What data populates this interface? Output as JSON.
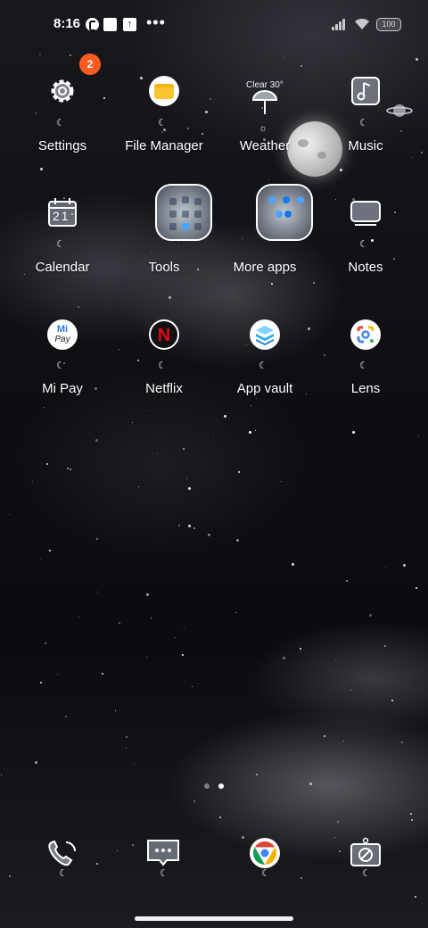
{
  "status_bar": {
    "time": "8:16",
    "battery": "100",
    "icons": [
      "notification-c-icon",
      "notification-square-icon",
      "upload-icon",
      "more-dots-icon",
      "signal-icon",
      "wifi-icon",
      "battery-icon"
    ]
  },
  "apps": [
    {
      "label": "Settings",
      "icon": "gear-icon",
      "badge": "2"
    },
    {
      "label": "File Manager",
      "icon": "folder-icon"
    },
    {
      "label": "Weather",
      "icon": "umbrella-icon",
      "widget_text": "Clear 30°"
    },
    {
      "label": "Music",
      "icon": "music-note-icon"
    },
    {
      "label": "Calendar",
      "icon": "calendar-icon",
      "day": "21"
    },
    {
      "label": "Tools",
      "icon": "folder-tools-icon"
    },
    {
      "label": "More apps",
      "icon": "folder-more-apps-icon"
    },
    {
      "label": "Notes",
      "icon": "notes-icon"
    },
    {
      "label": "Mi Pay",
      "icon": "mi-pay-icon",
      "logo_text_top": "Mi",
      "logo_text_bottom": "Pay"
    },
    {
      "label": "Netflix",
      "icon": "netflix-icon",
      "logo_text": "N"
    },
    {
      "label": "App vault",
      "icon": "app-vault-icon"
    },
    {
      "label": "Lens",
      "icon": "google-lens-icon"
    }
  ],
  "dock": [
    "phone-icon",
    "messages-icon",
    "chrome-icon",
    "camera-icon"
  ],
  "pages": {
    "count": 2,
    "active": 2
  },
  "colors": {
    "badge": "#ff5a1f",
    "netflix_red": "#e50914",
    "chrome_red": "#db4437",
    "chrome_yellow": "#f4b400",
    "chrome_green": "#0f9d58",
    "chrome_blue": "#4285f4"
  }
}
